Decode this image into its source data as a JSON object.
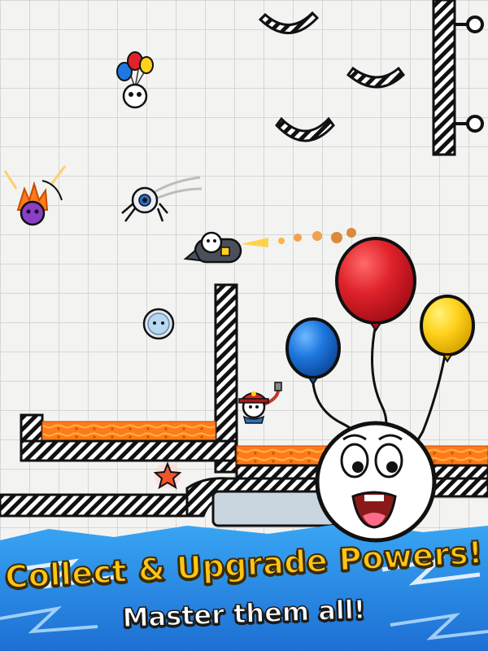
{
  "screen": {
    "headline": "Collect & Upgrade Powers!",
    "subline": "Master them all!"
  },
  "colors": {
    "lava": "#ff7a1a",
    "balloon_red": "#e0222b",
    "balloon_blue": "#1e78e0",
    "balloon_yellow": "#ffd21c",
    "banner_blue": "#2a8fe6",
    "headline_yellow": "#ffc515"
  },
  "characters": [
    {
      "name": "balloon-hero-character",
      "power": "balloons"
    },
    {
      "name": "fire-hero-character",
      "power": "fire"
    },
    {
      "name": "spider-hero-character",
      "power": "spider"
    },
    {
      "name": "rocket-hero-character",
      "power": "rocket"
    },
    {
      "name": "astronaut-hero-character",
      "power": "bubble-helmet"
    },
    {
      "name": "firefighter-hero-character",
      "power": "water-hose"
    },
    {
      "name": "main-ball-character",
      "power": "balloons"
    }
  ],
  "icons": [
    "star-icon",
    "balloon-icon",
    "hook-icon"
  ]
}
